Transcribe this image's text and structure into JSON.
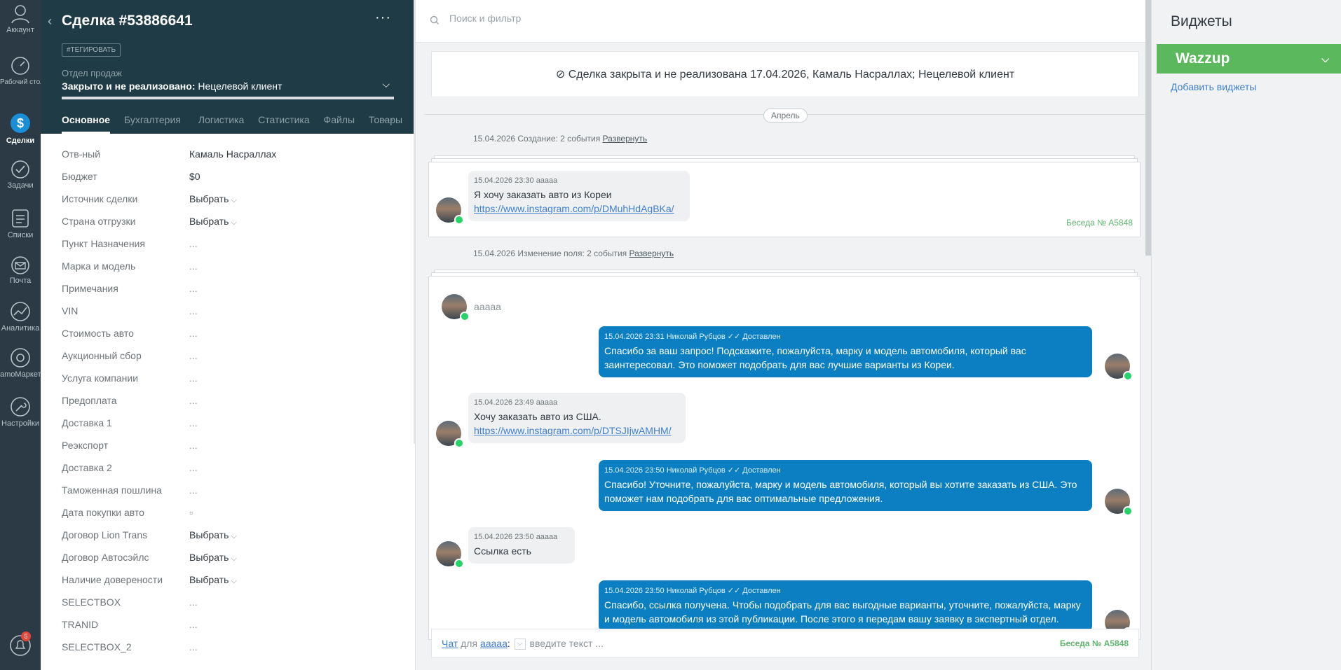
{
  "nav": {
    "items": [
      {
        "label": "Аккаунт"
      },
      {
        "label": "Рабочий стол"
      },
      {
        "label": "Сделки"
      },
      {
        "label": "Задачи"
      },
      {
        "label": "Списки"
      },
      {
        "label": "Почта"
      },
      {
        "label": "Аналитика"
      },
      {
        "label": "amoМаркет"
      },
      {
        "label": "Настройки"
      }
    ],
    "notifications_badge": "5"
  },
  "deal": {
    "title": "Сделка #53886641",
    "tag_button": "#ТЕГИРОВАТЬ",
    "pipeline": "Отдел продаж",
    "status_bold": "Закрыто и не реализовано:",
    "status_reason": "Нецелевой клиент",
    "tabs": [
      "Основное",
      "Бухгалтерия",
      "Логистика",
      "Статистика",
      "Файлы",
      "Товары"
    ],
    "fields": [
      {
        "label": "Отв-ный",
        "value": "Камаль Насраллах"
      },
      {
        "label": "Бюджет",
        "value": "$0"
      },
      {
        "label": "Источник сделки",
        "value": "Выбрать"
      },
      {
        "label": "Страна отгрузки",
        "value": "Выбрать"
      },
      {
        "label": "Пункт Назначения",
        "value": "..."
      },
      {
        "label": "Марка и модель",
        "value": "..."
      },
      {
        "label": "Примечания",
        "value": "..."
      },
      {
        "label": "VIN",
        "value": "..."
      },
      {
        "label": "Стоимость авто",
        "value": "..."
      },
      {
        "label": "Аукционный сбор",
        "value": "..."
      },
      {
        "label": "Услуга компании",
        "value": "..."
      },
      {
        "label": "Предоплата",
        "value": "..."
      },
      {
        "label": "Доставка 1",
        "value": "..."
      },
      {
        "label": "Реэкспорт",
        "value": "..."
      },
      {
        "label": "Доставка 2",
        "value": "..."
      },
      {
        "label": "Таможенная пошлина",
        "value": "..."
      },
      {
        "label": "Дата покупки авто",
        "value": "▫"
      },
      {
        "label": "Договор Lion Trans",
        "value": "Выбрать"
      },
      {
        "label": "Договор Автосэйлс",
        "value": "Выбрать"
      },
      {
        "label": "Наличие доверености",
        "value": "Выбрать"
      },
      {
        "label": "SELECTBOX",
        "value": "..."
      },
      {
        "label": "TRANID",
        "value": "..."
      },
      {
        "label": "SELECTBOX_2",
        "value": "..."
      }
    ]
  },
  "feed": {
    "search_placeholder": "Поиск и фильтр",
    "closed_banner": "Сделка закрыта и не реализована 17.04.2026, Камаль Насраллах; Нецелевой клиент",
    "month": "Апрель",
    "group1": {
      "text": "15.04.2026 Создание: 2 события",
      "expand": "Развернуть"
    },
    "group2": {
      "text": "15.04.2026 Изменение поля: 2 события",
      "expand": "Развернуть"
    },
    "conversation_id": "Беседа № A5848",
    "chat_name": "ааааа",
    "messages": [
      {
        "meta": "15.04.2026 23:30 ааааа",
        "text": "Я хочу заказать авто из Кореи",
        "link": "https://www.instagram.com/p/DMuhHdAgBKa/"
      },
      {
        "meta": "15.04.2026 23:31 Николай Рубцов",
        "status": "Доставлен",
        "text": "Спасибо за ваш запрос! Подскажите, пожалуйста, марку и модель автомобиля, который вас заинтересовал. Это поможет подобрать для вас лучшие варианты из Кореи."
      },
      {
        "meta": "15.04.2026 23:49 ааааа",
        "text": "Хочу заказать авто из США.",
        "link": "https://www.instagram.com/p/DTSJIjwAMHM/"
      },
      {
        "meta": "15.04.2026 23:50 Николай Рубцов",
        "status": "Доставлен",
        "text": "Спасибо! Уточните, пожалуйста, марку и модель автомобиля, который вы хотите заказать из США. Это поможет нам подобрать для вас оптимальные предложения."
      },
      {
        "meta": "15.04.2026 23:50 ааааа",
        "text": "Ссылка есть"
      },
      {
        "meta": "15.04.2026 23:50 Николай Рубцов",
        "status": "Доставлен",
        "text": "Спасибо, ссылка получена. Чтобы подобрать для вас выгодные варианты, уточните, пожалуйста, марку и модель автомобиля из этой публикации. После этого я передам вашу заявку в экспертный отдел."
      }
    ],
    "composer": {
      "mode": "Чат",
      "for": "для",
      "recipient": "ааааа",
      "placeholder": "введите текст ...",
      "conversation": "Беседа № A5848"
    }
  },
  "widgets": {
    "title": "Виджеты",
    "wazzup": "Wazzup",
    "add_link": "Добавить виджеты"
  },
  "colors": {
    "nav_bg": "#2b3a44",
    "deal_head_bg": "#1f3b45",
    "outgoing_bubble": "#0b7fc1",
    "wazzup_green": "#5cb85c"
  }
}
